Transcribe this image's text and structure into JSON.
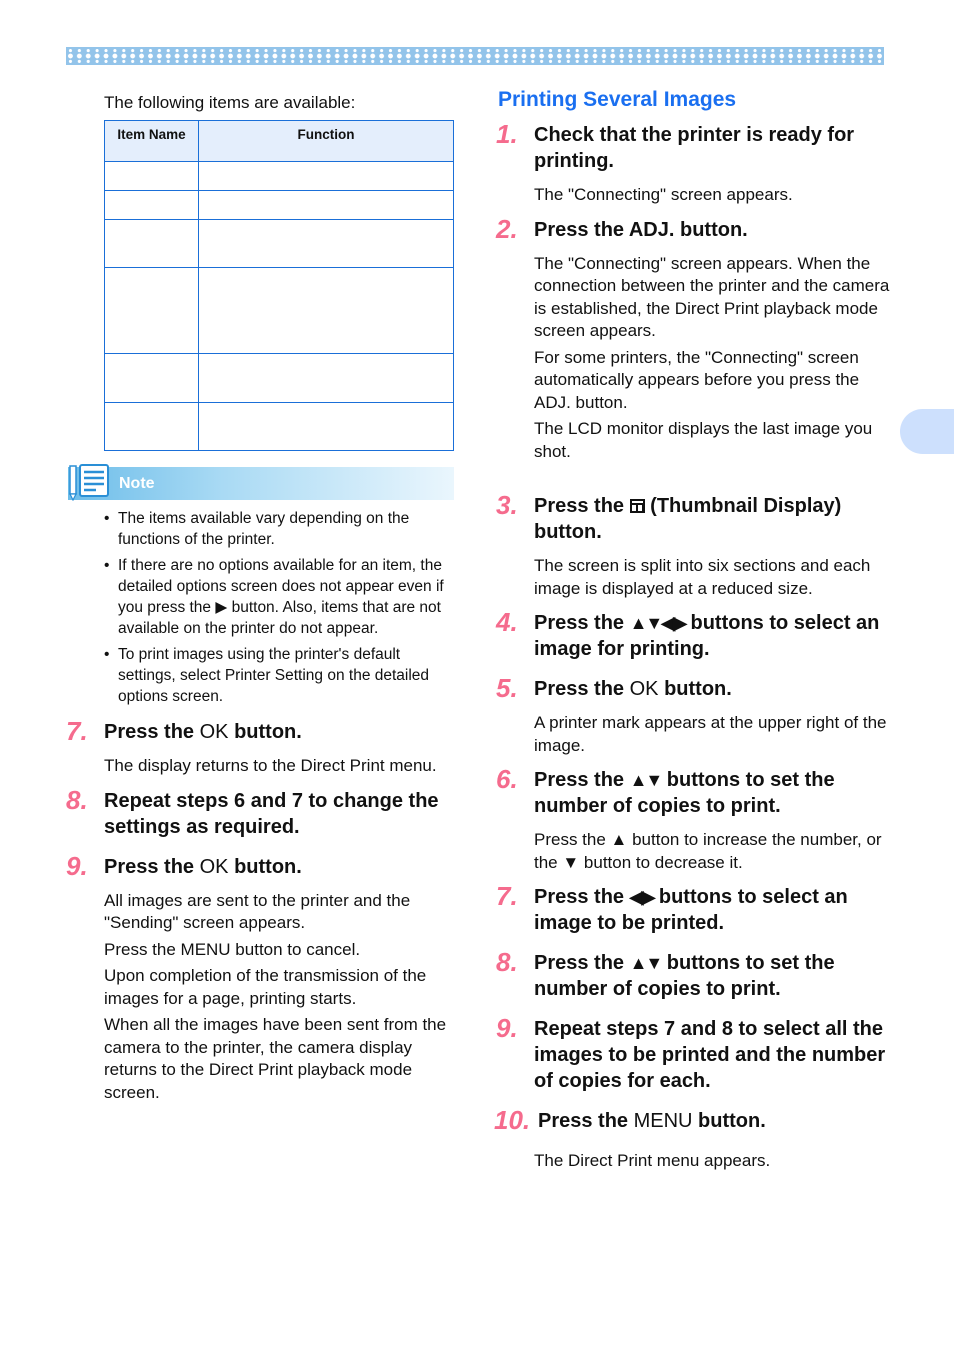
{
  "header": {
    "decoration": "diamond-pattern-band",
    "side_tab": "chapter-tab"
  },
  "left": {
    "intro": "The following items are available:",
    "table": {
      "headers": [
        "Item Name",
        "Function"
      ],
      "rows": [
        [
          "",
          ""
        ],
        [
          "",
          ""
        ],
        [
          "",
          ""
        ],
        [
          "",
          ""
        ],
        [
          "",
          ""
        ],
        [
          "",
          ""
        ]
      ]
    },
    "note": {
      "label": "Note",
      "icon": "notepad-pencil-icon",
      "items": [
        "The items available vary depending on the functions of the printer.",
        "If there are no options available for an item, the detailed options screen does not appear even if you press the ▶ button. Also, items that are not available on the printer do not appear.",
        "To print images using the printer's default settings, select Printer Setting on the detailed options screen."
      ]
    },
    "steps": [
      {
        "num": "7.",
        "title_pre": "Press the ",
        "title_key": "OK",
        "title_post": " button.",
        "body": [
          "The display returns to the Direct Print menu."
        ]
      },
      {
        "num": "8.",
        "title_pre": "Repeat steps 6 and 7 to change the settings as required.",
        "title_key": "",
        "title_post": "",
        "body": []
      },
      {
        "num": "9.",
        "title_pre": "Press the ",
        "title_key": "OK",
        "title_post": " button.",
        "body": [
          "All images are sent to the printer and the \"Sending\" screen appears.",
          "Press the MENU button to cancel.",
          "Upon completion of the transmission of the images for a page, printing starts.",
          "When all the images have been sent from the camera to the printer, the camera display returns to the Direct Print playback mode screen."
        ]
      }
    ]
  },
  "right": {
    "section_title": "Printing Several Images",
    "steps": [
      {
        "num": "1.",
        "title": "Check that the printer is ready for printing.",
        "body": [
          "The \"Connecting\" screen appears."
        ]
      },
      {
        "num": "2.",
        "title": "Press the ADJ. button.",
        "body": [
          "The \"Connecting\" screen appears. When the connection between the printer and the camera is established, the Direct Print playback mode screen appears.",
          "For some printers, the \"Connecting\" screen automatically appears before you press the ADJ. button.",
          "The LCD monitor displays the last image you shot."
        ]
      },
      {
        "num": "3.",
        "title_pre": "Press the ",
        "title_post": " (Thumbnail Display) button.",
        "body": [
          "The screen is split into six sections and each image is displayed at a reduced size."
        ]
      },
      {
        "num": "4.",
        "title_pre": "Press the ",
        "glyphs": "▲▼◀▶",
        "title_post": " buttons to select an image for printing.",
        "body": []
      },
      {
        "num": "5.",
        "title_pre": "Press the ",
        "title_key": "OK",
        "title_post": " button.",
        "body": [
          "A printer mark appears at the upper right of the image."
        ]
      },
      {
        "num": "6.",
        "title_pre": "Press the ",
        "glyphs": "▲▼",
        "title_post": " buttons to set the number of copies to print.",
        "body": [
          "Press the ▲ button to increase the number, or the ▼ button to decrease it."
        ]
      },
      {
        "num": "7.",
        "title_pre": "Press the ",
        "glyphs": "◀▶",
        "title_post": " buttons to select an image to be printed.",
        "body": []
      },
      {
        "num": "8.",
        "title_pre": "Press the ",
        "glyphs": "▲▼",
        "title_post": " buttons to set the number of copies to print.",
        "body": []
      },
      {
        "num": "9.",
        "title": "Repeat steps 7 and 8 to select all the images to be printed and the number of copies for each.",
        "body": []
      },
      {
        "num": "10.",
        "title_pre": "Press the ",
        "title_key": "MENU",
        "title_post": " button.",
        "body": [
          "The Direct Print menu appears."
        ]
      }
    ]
  }
}
